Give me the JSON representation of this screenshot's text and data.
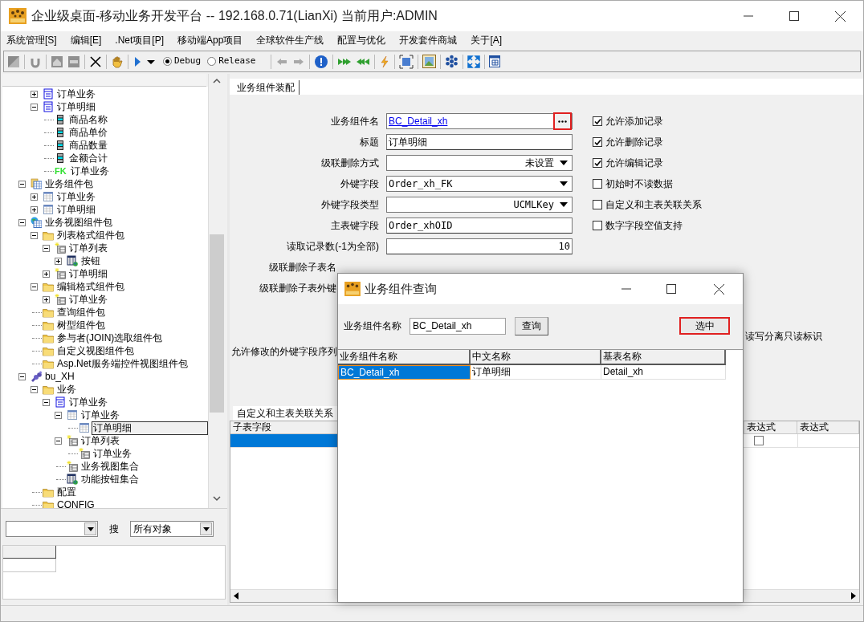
{
  "window": {
    "title": "企业级桌面-移动业务开发平台 -- 192.168.0.71(LianXi) 当前用户:ADMIN"
  },
  "menu": [
    "系统管理[S]",
    "编辑[E]",
    ".Net项目[P]",
    "移动端App项目",
    "全球软件生产线",
    "配置与优化",
    "开发套件商城",
    "关于[A]"
  ],
  "toolbar": {
    "build_modes": [
      {
        "label": "Debug",
        "selected": true
      },
      {
        "label": "Release",
        "selected": false
      }
    ]
  },
  "tree": {
    "items": [
      {
        "children": [
          {
            "label": "订单业务",
            "kind": "table",
            "expanded": false,
            "selected": false
          },
          {
            "label": "订单明细",
            "kind": "table",
            "expanded": true,
            "selected": false,
            "children": [
              {
                "label": "商品名称",
                "kind": "field",
                "selected": false
              },
              {
                "label": "商品单价",
                "kind": "field",
                "selected": false
              },
              {
                "label": "商品数量",
                "kind": "field",
                "selected": false
              },
              {
                "label": "金额合计",
                "kind": "field",
                "selected": false
              },
              {
                "label": "订单业务",
                "kind": "fk",
                "badge": "FK",
                "selected": false
              }
            ]
          }
        ]
      },
      {
        "label": "业务组件包",
        "kind": "package",
        "expanded": true,
        "selected": false,
        "children": [
          {
            "label": "订单业务",
            "kind": "grid",
            "expanded": false,
            "selected": false
          },
          {
            "label": "订单明细",
            "kind": "grid",
            "expanded": false,
            "selected": false
          }
        ]
      },
      {
        "label": "业务视图组件包",
        "kind": "globe",
        "expanded": true,
        "selected": false,
        "children": [
          {
            "label": "列表格式组件包",
            "kind": "folder",
            "expanded": true,
            "selected": false,
            "children": [
              {
                "label": "订单列表",
                "kind": "view",
                "expanded": true,
                "selected": false,
                "children": [
                  {
                    "label": "按钮",
                    "kind": "button",
                    "expanded": false,
                    "selected": false
                  }
                ]
              },
              {
                "label": "订单明细",
                "kind": "view",
                "expanded": false,
                "selected": false
              }
            ]
          },
          {
            "label": "编辑格式组件包",
            "kind": "folder",
            "expanded": true,
            "selected": false,
            "children": [
              {
                "label": "订单业务",
                "kind": "view",
                "expanded": false,
                "selected": false
              }
            ]
          },
          {
            "label": "查询组件包",
            "kind": "folder",
            "selected": false
          },
          {
            "label": "树型组件包",
            "kind": "folder",
            "selected": false
          },
          {
            "label": "参与者(JOIN)选取组件包",
            "kind": "folder",
            "selected": false
          },
          {
            "label": "自定义视图组件包",
            "kind": "folder",
            "selected": false
          },
          {
            "label": "Asp.Net服务端控件视图组件包",
            "kind": "folder",
            "selected": false
          }
        ]
      },
      {
        "label": "bu_XH",
        "kind": "gears",
        "expanded": true,
        "selected": false,
        "children": [
          {
            "label": "业务",
            "kind": "folder",
            "expanded": true,
            "selected": false,
            "children": [
              {
                "label": "订单业务",
                "kind": "table",
                "expanded": true,
                "selected": false,
                "children": [
                  {
                    "label": "订单业务",
                    "kind": "grid",
                    "expanded": true,
                    "selected": false,
                    "children": [
                      {
                        "label": "订单明细",
                        "kind": "grid",
                        "selected": true
                      }
                    ]
                  },
                  {
                    "label": "订单列表",
                    "kind": "view",
                    "expanded": true,
                    "selected": false,
                    "children": [
                      {
                        "label": "订单业务",
                        "kind": "view",
                        "selected": false
                      }
                    ]
                  },
                  {
                    "label": "业务视图集合",
                    "kind": "view",
                    "selected": false
                  },
                  {
                    "label": "功能按钮集合",
                    "kind": "button",
                    "selected": false
                  }
                ]
              }
            ]
          },
          {
            "label": "配置",
            "kind": "folder",
            "selected": false
          },
          {
            "label": "CONFIG",
            "kind": "folder",
            "selected": false
          }
        ]
      }
    ]
  },
  "search": {
    "label": "搜",
    "scope": "所有对象"
  },
  "editor": {
    "tab": "业务组件装配",
    "fields": [
      {
        "label": "业务组件名",
        "kind": "lookup",
        "value": "BC_Detail_xh",
        "highlighted": true
      },
      {
        "label": "标题",
        "kind": "text",
        "value": "订单明细"
      },
      {
        "label": "级联删除方式",
        "kind": "select",
        "value": "未设置"
      },
      {
        "label": "外键字段",
        "kind": "combo",
        "value": "Order_xh_FK"
      },
      {
        "label": "外键字段类型",
        "kind": "select",
        "value": "UCMLKey"
      },
      {
        "label": "主表键字段",
        "kind": "text",
        "value": "Order_xhOID"
      },
      {
        "label": "读取记录数(-1为全部)",
        "kind": "number",
        "value": "10"
      },
      {
        "label": "级联删除子表名",
        "kind": "covered"
      },
      {
        "label": "级联删除子表外键",
        "kind": "covered"
      }
    ],
    "options": [
      {
        "label": "允许添加记录",
        "checked": true
      },
      {
        "label": "允许删除记录",
        "checked": true
      },
      {
        "label": "允许编辑记录",
        "checked": true
      },
      {
        "label": "初始时不读数据",
        "checked": false
      },
      {
        "label": "自定义和主表关联关系",
        "checked": false
      },
      {
        "label": "数字字段空值支持",
        "checked": false
      }
    ],
    "sequence_label": "允许修改的外键字段序列",
    "partial_option_label": "读写分离只读标识",
    "relation_tab": "自定义和主表关联关系",
    "relation_grid": {
      "columns": [
        "子表字段",
        "表达式",
        "表达式"
      ],
      "rows": [
        {
          "selected": true,
          "checked": false
        }
      ]
    }
  },
  "dialog": {
    "title": "业务组件查询",
    "query_label": "业务组件名称",
    "query_value": "BC_Detail_xh",
    "query_button": "查询",
    "select_button": {
      "label": "选中",
      "highlighted": true
    },
    "grid": {
      "columns": [
        "业务组件名称",
        "中文名称",
        "基表名称"
      ],
      "rows": [
        {
          "selected": true,
          "cells": [
            "BC_Detail_xh",
            "订单明细",
            "Detail_xh"
          ]
        }
      ]
    }
  }
}
